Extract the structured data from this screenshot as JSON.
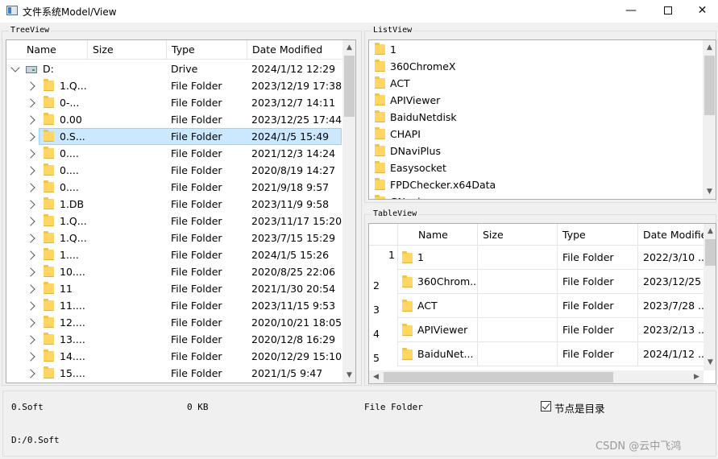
{
  "window": {
    "title": "文件系统Model/View"
  },
  "tree": {
    "group_title": "TreeView",
    "columns": [
      "Name",
      "Size",
      "Type",
      "Date Modified"
    ],
    "root": {
      "name": "D:",
      "type": "Drive",
      "date": "2024/1/12 12:29"
    },
    "rows": [
      {
        "name": "1.Q...",
        "type": "File Folder",
        "date": "2023/12/19 17:38"
      },
      {
        "name": "0-...",
        "type": "File Folder",
        "date": "2023/12/7 14:11"
      },
      {
        "name": "0.00",
        "type": "File Folder",
        "date": "2023/12/25 17:44"
      },
      {
        "name": "0.S...",
        "type": "File Folder",
        "date": "2024/1/5 15:49"
      },
      {
        "name": "0....",
        "type": "File Folder",
        "date": "2021/12/3 14:24"
      },
      {
        "name": "0....",
        "type": "File Folder",
        "date": "2020/8/19 14:27"
      },
      {
        "name": "0....",
        "type": "File Folder",
        "date": "2021/9/18 9:57"
      },
      {
        "name": "1.DB",
        "type": "File Folder",
        "date": "2023/11/9 9:58"
      },
      {
        "name": "1.Q...",
        "type": "File Folder",
        "date": "2023/11/17 15:20"
      },
      {
        "name": "1.Q...",
        "type": "File Folder",
        "date": "2023/7/15 15:29"
      },
      {
        "name": "1....",
        "type": "File Folder",
        "date": "2024/1/5 15:26"
      },
      {
        "name": "10....",
        "type": "File Folder",
        "date": "2020/8/25 22:06"
      },
      {
        "name": "11",
        "type": "File Folder",
        "date": "2021/1/30 20:54"
      },
      {
        "name": "11....",
        "type": "File Folder",
        "date": "2023/11/15 9:53"
      },
      {
        "name": "12....",
        "type": "File Folder",
        "date": "2020/10/21 18:05"
      },
      {
        "name": "13....",
        "type": "File Folder",
        "date": "2020/12/8 16:29"
      },
      {
        "name": "14....",
        "type": "File Folder",
        "date": "2020/12/29 15:10"
      },
      {
        "name": "15....",
        "type": "File Folder",
        "date": "2021/1/5 9:47"
      }
    ]
  },
  "list": {
    "group_title": "ListView",
    "items": [
      "1",
      "360ChromeX",
      "ACT",
      "APIViewer",
      "BaiduNetdisk",
      "CHAPI",
      "DNaviPlus",
      "Easysocket",
      "FPDChecker.x64Data",
      "GNavi..."
    ]
  },
  "table": {
    "group_title": "TableView",
    "columns": [
      "Name",
      "Size",
      "Type",
      "Date Modifie"
    ],
    "rows": [
      {
        "num": "1",
        "name": "1",
        "type": "File Folder",
        "date": "2022/3/10 ..."
      },
      {
        "num": "2",
        "name": "360Chrom...",
        "type": "File Folder",
        "date": "2023/12/25 ..."
      },
      {
        "num": "3",
        "name": "ACT",
        "type": "File Folder",
        "date": "2023/7/28 ..."
      },
      {
        "num": "4",
        "name": "APIViewer",
        "type": "File Folder",
        "date": "2023/2/13 ..."
      },
      {
        "num": "5",
        "name": "BaiduNet...",
        "type": "File Folder",
        "date": "2024/1/12 ..."
      }
    ]
  },
  "status": {
    "name": "0.Soft",
    "size": "0 KB",
    "type": "File Folder",
    "checkbox_label": "节点是目录",
    "checkbox_checked": true,
    "path": "D:/0.Soft"
  },
  "watermark": "CSDN @云中飞鸿",
  "colors": {
    "selection": "#cce8ff",
    "folder": "#ffd662"
  }
}
